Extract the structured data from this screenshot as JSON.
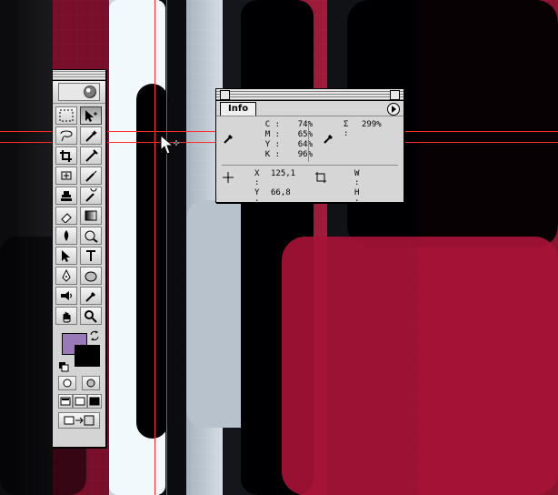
{
  "window": {
    "title": ""
  },
  "info": {
    "tab_label": "Info",
    "cmyk": [
      {
        "label": "C :",
        "value": "74%"
      },
      {
        "label": "M :",
        "value": "65%"
      },
      {
        "label": "Y :",
        "value": "64%"
      },
      {
        "label": "K :",
        "value": "96%"
      }
    ],
    "total_ink": {
      "label": "Σ :",
      "value": "299%"
    },
    "coords": [
      {
        "label": "X :",
        "value": "125,1"
      },
      {
        "label": "Y :",
        "value": "66,8"
      }
    ],
    "size": [
      {
        "label": "W :",
        "value": ""
      },
      {
        "label": "H :",
        "value": ""
      }
    ]
  },
  "toolbox": {
    "icons": [
      "marquee-icon",
      "move-icon",
      "lasso-icon",
      "magic-wand-icon",
      "crop-icon",
      "slice-icon",
      "healing-icon",
      "brush-icon",
      "stamp-icon",
      "history-brush-icon",
      "eraser-icon",
      "gradient-icon",
      "blur-icon",
      "dodge-icon",
      "path-select-icon",
      "type-icon",
      "pen-icon",
      "shape-icon",
      "notes-icon",
      "eyedropper-icon",
      "hand-icon",
      "zoom-icon"
    ]
  },
  "colors": {
    "foreground": "#9A79B8",
    "background": "#000000",
    "guides": "#FF2D2D"
  }
}
